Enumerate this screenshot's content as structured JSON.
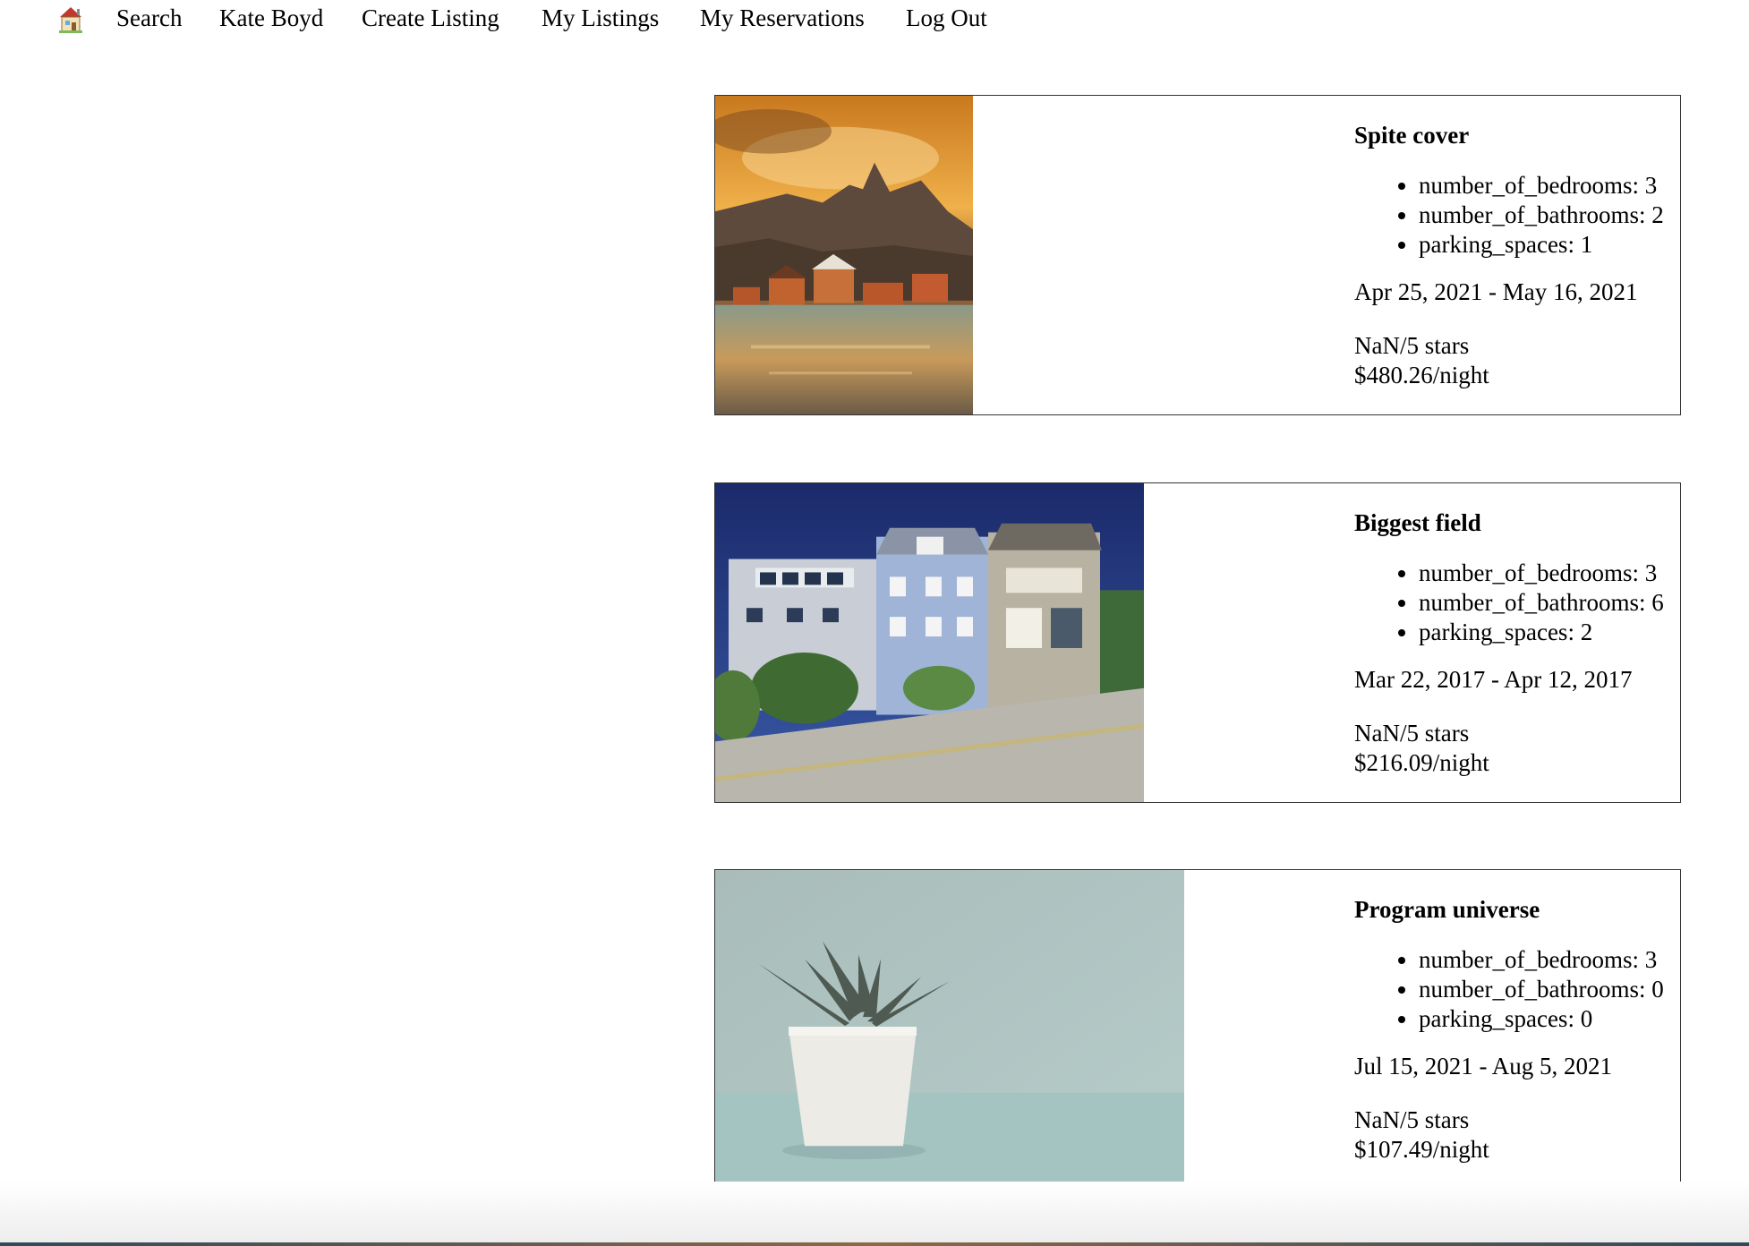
{
  "nav": {
    "home_icon": "house-icon",
    "links": [
      "Search",
      "Kate Boyd",
      "Create Listing",
      "My Listings",
      "My Reservations",
      "Log Out"
    ]
  },
  "listings": [
    {
      "title": "Spite cover",
      "features": [
        "number_of_bedrooms: 3",
        "number_of_bathrooms: 2",
        "parking_spaces: 1"
      ],
      "dates": "Apr 25, 2021 - May 16, 2021",
      "stars": "NaN/5 stars",
      "price": "$480.26/night"
    },
    {
      "title": "Biggest field",
      "features": [
        "number_of_bedrooms: 3",
        "number_of_bathrooms: 6",
        "parking_spaces: 2"
      ],
      "dates": "Mar 22, 2017 - Apr 12, 2017",
      "stars": "NaN/5 stars",
      "price": "$216.09/night"
    },
    {
      "title": "Program universe",
      "features": [
        "number_of_bedrooms: 3",
        "number_of_bathrooms: 0",
        "parking_spaces: 0"
      ],
      "dates": "Jul 15, 2021 - Aug 5, 2021",
      "stars": "NaN/5 stars",
      "price": "$107.49/night"
    }
  ]
}
